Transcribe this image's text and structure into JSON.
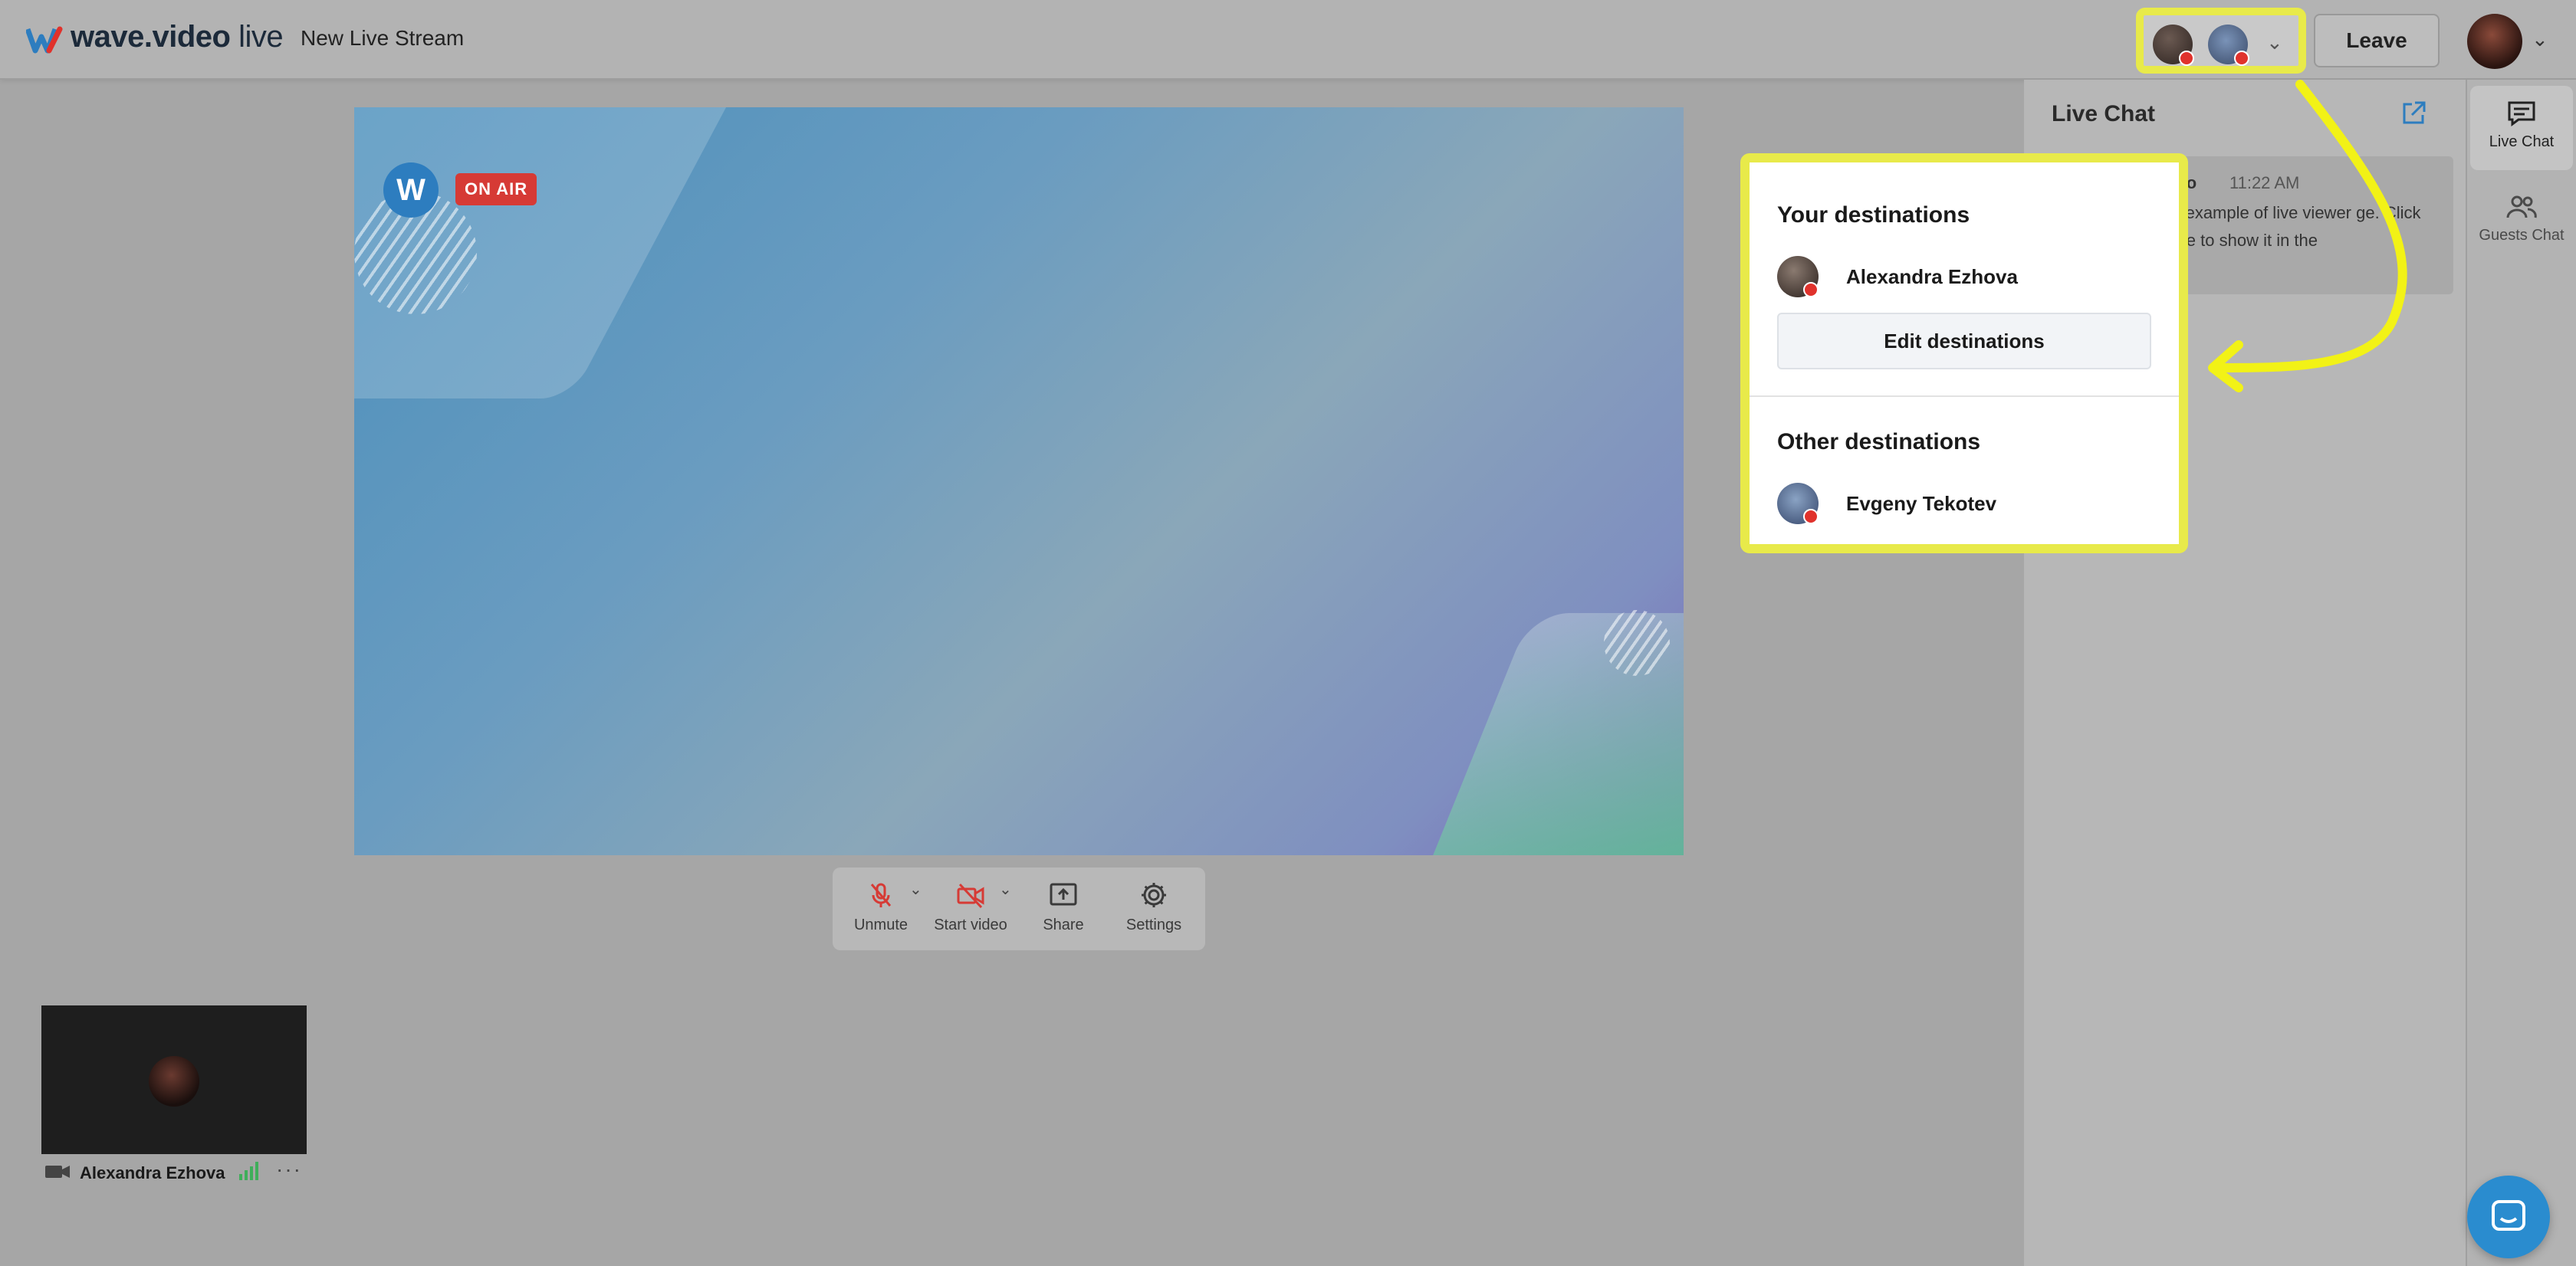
{
  "app": {
    "logo_name": "wave.video",
    "logo_suffix": "live",
    "stream_title": "New Live Stream"
  },
  "header": {
    "leave_label": "Leave"
  },
  "stage": {
    "on_air_label": "ON AIR",
    "logo_letter": "W"
  },
  "toolbar": {
    "unmute_label": "Unmute",
    "start_video_label": "Start video",
    "share_label": "Share",
    "settings_label": "Settings"
  },
  "self_view": {
    "name": "Alexandra Ezhova",
    "more_label": "···"
  },
  "chat": {
    "title": "Live Chat",
    "message": {
      "author": "ideo",
      "time": "11:22 AM",
      "text": "an example of live viewer ge. Click here to show it in the"
    }
  },
  "rail": {
    "live_chat_label": "Live Chat",
    "guests_chat_label": "Guests Chat"
  },
  "destinations": {
    "your_title": "Your destinations",
    "your_items": [
      {
        "name": "Alexandra Ezhova"
      }
    ],
    "edit_label": "Edit destinations",
    "other_title": "Other destinations",
    "other_items": [
      {
        "name": "Evgeny Tekotev"
      }
    ]
  },
  "colors": {
    "highlight": "#e8ea4a",
    "on_air": "#d63a35",
    "brand_blue": "#2d7dbf",
    "mute_red": "#d63a35",
    "help_button": "#2a8ccf",
    "signal_green": "#3fae5a"
  },
  "icons": {
    "mic": "mic-off-icon",
    "video": "video-off-icon",
    "share": "share-screen-icon",
    "settings": "gear-icon",
    "popout": "external-link-icon",
    "chat": "chat-icon",
    "guests": "users-icon",
    "help": "help-chat-icon"
  }
}
